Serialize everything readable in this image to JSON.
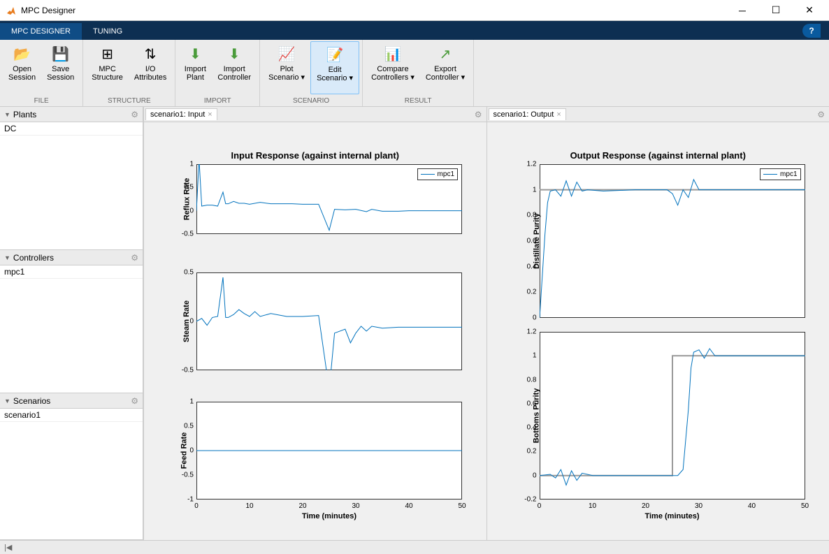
{
  "window": {
    "title": "MPC Designer"
  },
  "tabs": {
    "designer": "MPC DESIGNER",
    "tuning": "TUNING"
  },
  "toolstrip": {
    "file": {
      "label": "FILE",
      "open": "Open\nSession",
      "save": "Save\nSession"
    },
    "structure": {
      "label": "STRUCTURE",
      "mpc": "MPC\nStructure",
      "io": "I/O\nAttributes"
    },
    "import": {
      "label": "IMPORT",
      "plant": "Import\nPlant",
      "controller": "Import\nController"
    },
    "scenario": {
      "label": "SCENARIO",
      "plot": "Plot\nScenario ▾",
      "edit": "Edit\nScenario ▾"
    },
    "result": {
      "label": "RESULT",
      "compare": "Compare\nControllers ▾",
      "export": "Export\nController ▾"
    }
  },
  "sidebar": {
    "plants": {
      "title": "Plants",
      "items": [
        "DC"
      ]
    },
    "controllers": {
      "title": "Controllers",
      "items": [
        "mpc1"
      ]
    },
    "scenarios": {
      "title": "Scenarios",
      "items": [
        "scenario1"
      ]
    }
  },
  "plotTabs": {
    "input": "scenario1: Input",
    "output": "scenario1: Output"
  },
  "legend": "mpc1",
  "chart_data": [
    {
      "type": "line",
      "title": "Input Response (against internal plant)",
      "xlabel": "Time (minutes)",
      "xlim": [
        0,
        50
      ],
      "xticks": [
        0,
        10,
        20,
        30,
        40,
        50
      ],
      "subplots": [
        {
          "ylabel": "Reflux Rate",
          "ylim": [
            -0.5,
            1
          ],
          "yticks": [
            -0.5,
            0,
            0.5,
            1
          ],
          "series": [
            {
              "name": "mpc1",
              "data": [
                [
                  0,
                  0
                ],
                [
                  0.5,
                  1.1
                ],
                [
                  1,
                  0.1
                ],
                [
                  2,
                  0.12
                ],
                [
                  3,
                  0.12
                ],
                [
                  4,
                  0.1
                ],
                [
                  5,
                  0.4
                ],
                [
                  5.5,
                  0.15
                ],
                [
                  6,
                  0.15
                ],
                [
                  7,
                  0.2
                ],
                [
                  8,
                  0.16
                ],
                [
                  9,
                  0.16
                ],
                [
                  10,
                  0.14
                ],
                [
                  12,
                  0.18
                ],
                [
                  14,
                  0.15
                ],
                [
                  18,
                  0.15
                ],
                [
                  20,
                  0.14
                ],
                [
                  23,
                  0.14
                ],
                [
                  25,
                  -0.42
                ],
                [
                  26,
                  0.03
                ],
                [
                  28,
                  0.02
                ],
                [
                  30,
                  0.03
                ],
                [
                  32,
                  -0.02
                ],
                [
                  33,
                  0.03
                ],
                [
                  35,
                  -0.01
                ],
                [
                  38,
                  -0.01
                ],
                [
                  40,
                  0.0
                ],
                [
                  45,
                  0.0
                ],
                [
                  50,
                  0.0
                ]
              ]
            }
          ]
        },
        {
          "ylabel": "Steam Rate",
          "ylim": [
            -0.5,
            0.5
          ],
          "yticks": [
            -0.5,
            0,
            0.5
          ],
          "series": [
            {
              "name": "mpc1",
              "data": [
                [
                  0,
                  0
                ],
                [
                  1,
                  0.03
                ],
                [
                  2,
                  -0.04
                ],
                [
                  3,
                  0.04
                ],
                [
                  4,
                  0.05
                ],
                [
                  5,
                  0.45
                ],
                [
                  5.5,
                  0.04
                ],
                [
                  6,
                  0.04
                ],
                [
                  7,
                  0.07
                ],
                [
                  8,
                  0.12
                ],
                [
                  9,
                  0.08
                ],
                [
                  10,
                  0.05
                ],
                [
                  11,
                  0.1
                ],
                [
                  12,
                  0.05
                ],
                [
                  14,
                  0.08
                ],
                [
                  17,
                  0.05
                ],
                [
                  20,
                  0.05
                ],
                [
                  23,
                  0.06
                ],
                [
                  25,
                  -0.7
                ],
                [
                  26,
                  -0.12
                ],
                [
                  28,
                  -0.08
                ],
                [
                  29,
                  -0.22
                ],
                [
                  30,
                  -0.12
                ],
                [
                  31,
                  -0.05
                ],
                [
                  32,
                  -0.1
                ],
                [
                  33,
                  -0.05
                ],
                [
                  35,
                  -0.07
                ],
                [
                  38,
                  -0.06
                ],
                [
                  40,
                  -0.06
                ],
                [
                  45,
                  -0.06
                ],
                [
                  50,
                  -0.06
                ]
              ]
            }
          ]
        },
        {
          "ylabel": "Feed Rate",
          "ylim": [
            -1,
            1
          ],
          "yticks": [
            -1,
            -0.5,
            0,
            0.5,
            1
          ],
          "series": [
            {
              "name": "mpc1",
              "data": [
                [
                  0,
                  0
                ],
                [
                  50,
                  0
                ]
              ]
            }
          ]
        }
      ]
    },
    {
      "type": "line",
      "title": "Output Response (against internal plant)",
      "xlabel": "Time (minutes)",
      "xlim": [
        0,
        50
      ],
      "xticks": [
        0,
        10,
        20,
        30,
        40,
        50
      ],
      "subplots": [
        {
          "ylabel": "Distillate Purity",
          "ylim": [
            0,
            1.2
          ],
          "yticks": [
            0,
            0.2,
            0.4,
            0.6,
            0.8,
            1,
            1.2
          ],
          "ref": [
            [
              0,
              1
            ],
            [
              50,
              1
            ]
          ],
          "series": [
            {
              "name": "mpc1",
              "data": [
                [
                  0,
                  0
                ],
                [
                  1,
                  0.65
                ],
                [
                  1.5,
                  0.9
                ],
                [
                  2,
                  0.99
                ],
                [
                  3,
                  1.0
                ],
                [
                  4,
                  0.95
                ],
                [
                  5,
                  1.07
                ],
                [
                  6,
                  0.95
                ],
                [
                  7,
                  1.06
                ],
                [
                  8,
                  0.99
                ],
                [
                  9,
                  1.0
                ],
                [
                  12,
                  0.99
                ],
                [
                  18,
                  1.0
                ],
                [
                  24,
                  1.0
                ],
                [
                  25,
                  0.97
                ],
                [
                  26,
                  0.88
                ],
                [
                  27,
                  1.0
                ],
                [
                  28,
                  0.94
                ],
                [
                  29,
                  1.08
                ],
                [
                  30,
                  1.0
                ],
                [
                  32,
                  1.0
                ],
                [
                  40,
                  1.0
                ],
                [
                  50,
                  1.0
                ]
              ]
            }
          ]
        },
        {
          "ylabel": "Bottoms Purity",
          "ylim": [
            -0.2,
            1.2
          ],
          "yticks": [
            -0.2,
            0,
            0.2,
            0.4,
            0.6,
            0.8,
            1,
            1.2
          ],
          "ref": [
            [
              0,
              0
            ],
            [
              25,
              0
            ],
            [
              25,
              1
            ],
            [
              50,
              1
            ]
          ],
          "series": [
            {
              "name": "mpc1",
              "data": [
                [
                  0,
                  0
                ],
                [
                  2,
                  0.01
                ],
                [
                  3,
                  -0.02
                ],
                [
                  4,
                  0.05
                ],
                [
                  5,
                  -0.08
                ],
                [
                  6,
                  0.04
                ],
                [
                  7,
                  -0.04
                ],
                [
                  8,
                  0.02
                ],
                [
                  10,
                  0.0
                ],
                [
                  15,
                  0.0
                ],
                [
                  22,
                  0.0
                ],
                [
                  26,
                  0.0
                ],
                [
                  27,
                  0.05
                ],
                [
                  28,
                  0.55
                ],
                [
                  28.5,
                  0.9
                ],
                [
                  29,
                  1.03
                ],
                [
                  30,
                  1.05
                ],
                [
                  31,
                  0.98
                ],
                [
                  32,
                  1.06
                ],
                [
                  33,
                  1.0
                ],
                [
                  35,
                  1.0
                ],
                [
                  40,
                  1.0
                ],
                [
                  50,
                  1.0
                ]
              ]
            }
          ]
        }
      ]
    }
  ]
}
